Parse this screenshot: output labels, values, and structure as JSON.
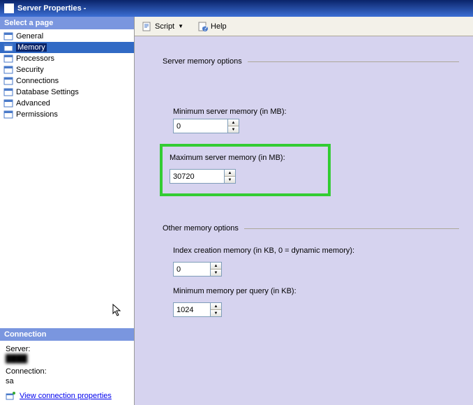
{
  "titlebar": {
    "text": "Server Properties - "
  },
  "left": {
    "select_header": "Select a page",
    "pages": [
      {
        "label": "General"
      },
      {
        "label": "Memory"
      },
      {
        "label": "Processors"
      },
      {
        "label": "Security"
      },
      {
        "label": "Connections"
      },
      {
        "label": "Database Settings"
      },
      {
        "label": "Advanced"
      },
      {
        "label": "Permissions"
      }
    ],
    "connection_header": "Connection",
    "server_label": "Server:",
    "server_value": "████",
    "connection_label": "Connection:",
    "connection_value": "sa",
    "view_link": "View connection properties"
  },
  "toolbar": {
    "script": "Script",
    "help": "Help"
  },
  "content": {
    "group1": "Server memory options",
    "min_mem_label": "Minimum server memory (in MB):",
    "min_mem_value": "0",
    "max_mem_label": "Maximum server memory (in MB):",
    "max_mem_value": "30720",
    "group2": "Other memory options",
    "index_mem_label": "Index creation memory (in KB, 0 = dynamic memory):",
    "index_mem_value": "0",
    "min_query_label": "Minimum memory per query (in KB):",
    "min_query_value": "1024"
  }
}
